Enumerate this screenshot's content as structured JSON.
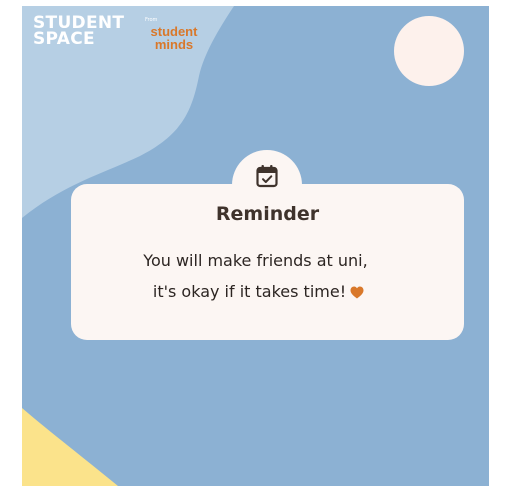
{
  "brand": {
    "student": "STUDENT",
    "space": "SPACE",
    "from": "From",
    "student_minds_1": "student",
    "student_minds_2": "minds"
  },
  "card": {
    "title": "Reminder",
    "line_1": "You will make friends at uni,",
    "line_2": "it's okay if it takes time!"
  },
  "icons": {
    "calendar": "calendar-check-icon",
    "heart": "heart-icon"
  },
  "colors": {
    "background": "#8cb1d3",
    "light_wave": "#b6cfe4",
    "sun": "#fdf1ec",
    "card": "#fcf6f3",
    "accent_orange": "#d9782a",
    "yellow_corner": "#fbe38b",
    "title_text": "#3f332c"
  }
}
